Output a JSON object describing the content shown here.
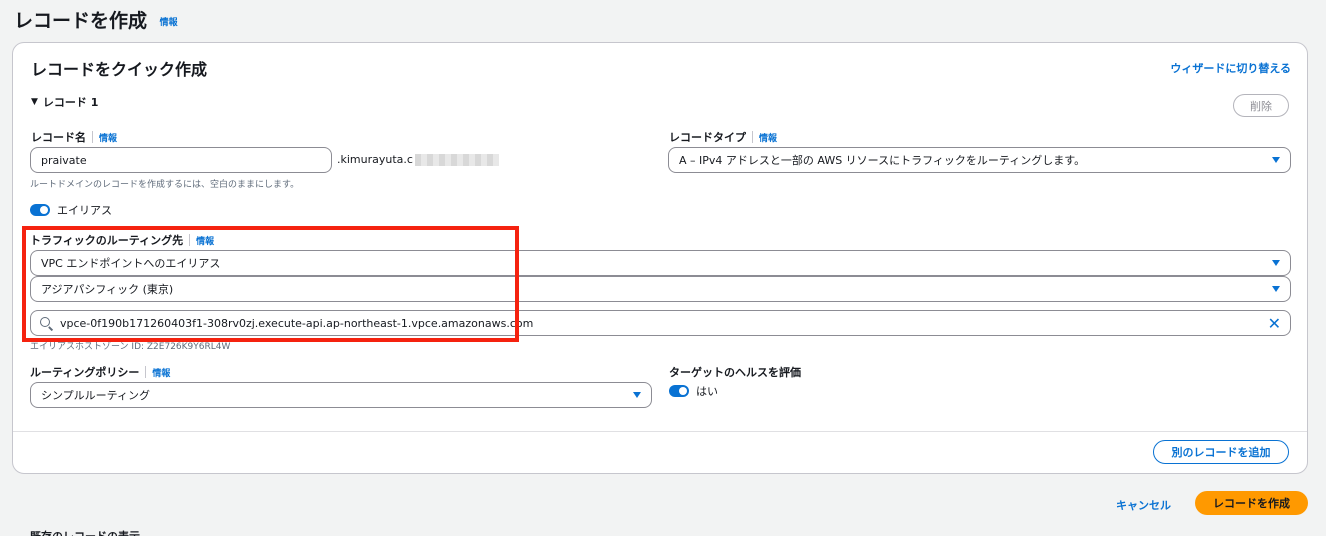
{
  "page": {
    "title": "レコードを作成",
    "info": "情報"
  },
  "card": {
    "title": "レコードをクイック作成",
    "wizard_link": "ウィザードに切り替える"
  },
  "record": {
    "section_label": "レコード 1",
    "delete": "削除",
    "name_label": "レコード名",
    "name_info": "情報",
    "name_value": "praivate",
    "domain_suffix": ".kimurayuta.c",
    "name_hint": "ルートドメインのレコードを作成するには、空白のままにします。",
    "type_label": "レコードタイプ",
    "type_info": "情報",
    "type_value": "A – IPv4 アドレスと一部の AWS リソースにトラフィックをルーティングします。",
    "alias_label": "エイリアス",
    "route_label": "トラフィックのルーティング先",
    "route_info": "情報",
    "route_target": "VPC エンドポイントへのエイリアス",
    "region": "アジアパシフィック (東京)",
    "endpoint_value": "vpce-0f190b171260403f1-308rv0zj.execute-api.ap-northeast-1.vpce.amazonaws.com",
    "hosted_zone_hint": "エイリアスホストゾーン ID: Z2E726K9Y6RL4W",
    "policy_label": "ルーティングポリシー",
    "policy_info": "情報",
    "policy_value": "シンプルルーティング",
    "health_label": "ターゲットのヘルスを評価",
    "health_value": "はい"
  },
  "actions": {
    "add_record": "別のレコードを追加",
    "cancel": "キャンセル",
    "create": "レコードを作成"
  },
  "below": {
    "cut_text": "既存のレコードの表示"
  },
  "colors": {
    "accent": "#0972d3",
    "primary_button": "#ff9900",
    "highlight": "#f5220f"
  }
}
